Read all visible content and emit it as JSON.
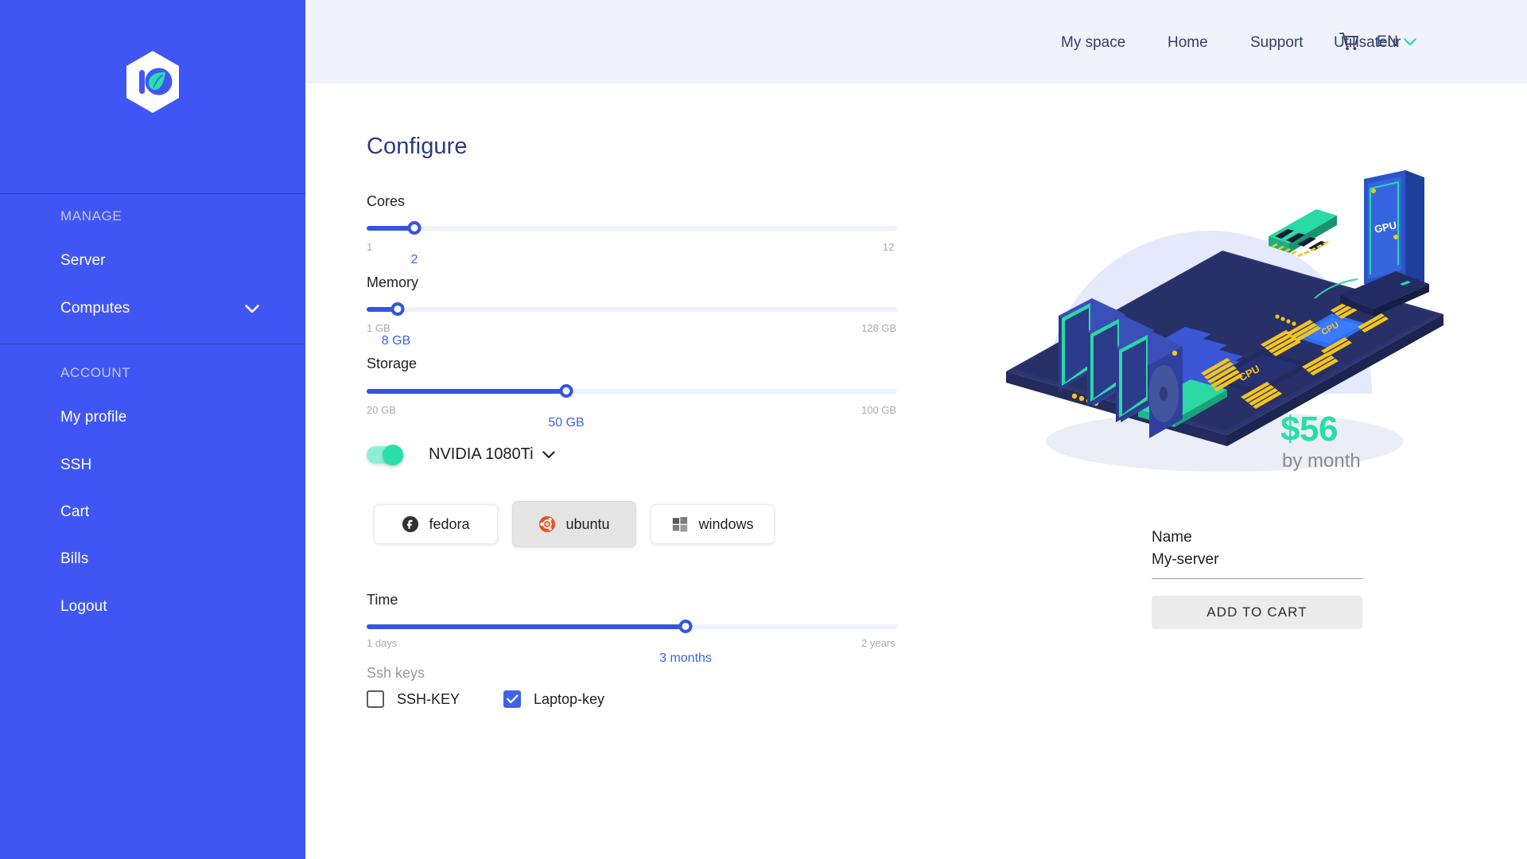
{
  "brand": {
    "logo_icon": "hexagon-leaf-logo",
    "sidebar_color": "#4056F4",
    "accent_color": "#3355E0",
    "teal_color": "#26DFA6"
  },
  "sidebar": {
    "groups": [
      {
        "title": "MANAGE",
        "items": [
          {
            "label": "Server",
            "has_chevron": false
          },
          {
            "label": "Computes",
            "has_chevron": true,
            "icon": "chevron-down-icon"
          }
        ]
      },
      {
        "title": "ACCOUNT",
        "items": [
          {
            "label": "My profile",
            "has_chevron": false
          },
          {
            "label": "SSH",
            "has_chevron": false
          },
          {
            "label": "Cart",
            "has_chevron": false
          },
          {
            "label": "Bills",
            "has_chevron": false
          },
          {
            "label": "Logout",
            "has_chevron": false
          }
        ]
      }
    ]
  },
  "header": {
    "links": [
      "My space",
      "Home",
      "Support",
      "Utilisateur"
    ],
    "cart_icon": "shopping-cart-icon",
    "language": "EN",
    "language_chevron": "chevron-down-icon"
  },
  "main": {
    "title": "Configure",
    "sliders": [
      {
        "label": "Cores",
        "min": "1",
        "max": "12",
        "value": "2",
        "percent": 9.0
      },
      {
        "label": "Memory",
        "min": "1 GB",
        "max": "128 GB",
        "value": "8 GB",
        "percent": 5.8
      },
      {
        "label": "Storage",
        "min": "20 GB",
        "max": "100 GB",
        "value": "50 GB",
        "percent": 37.6
      }
    ],
    "gpu": {
      "enabled": true,
      "name": "NVIDIA 1080Ti",
      "chevron": "chevron-down-icon"
    },
    "os_options": [
      {
        "name": "fedora",
        "icon": "fedora-icon",
        "selected": false
      },
      {
        "name": "ubuntu",
        "icon": "ubuntu-icon",
        "selected": true
      },
      {
        "name": "windows",
        "icon": "windows-icon",
        "selected": false
      }
    ],
    "time": {
      "label": "Time",
      "min": "1 days",
      "max": "2 years",
      "value": "3 months",
      "percent": 60.1
    },
    "ssh": {
      "title": "Ssh keys",
      "keys": [
        {
          "label": "SSH-KEY",
          "checked": false
        },
        {
          "label": "Laptop-key",
          "checked": true
        }
      ]
    }
  },
  "summary": {
    "illustration": "isometric-server-motherboard",
    "illustration_labels": [
      "GPU",
      "CPU",
      "CPU"
    ],
    "price": "$56",
    "price_period": "by month",
    "name_label": "Name",
    "name_value": "My-server",
    "add_to_cart_label": "ADD TO CART"
  }
}
